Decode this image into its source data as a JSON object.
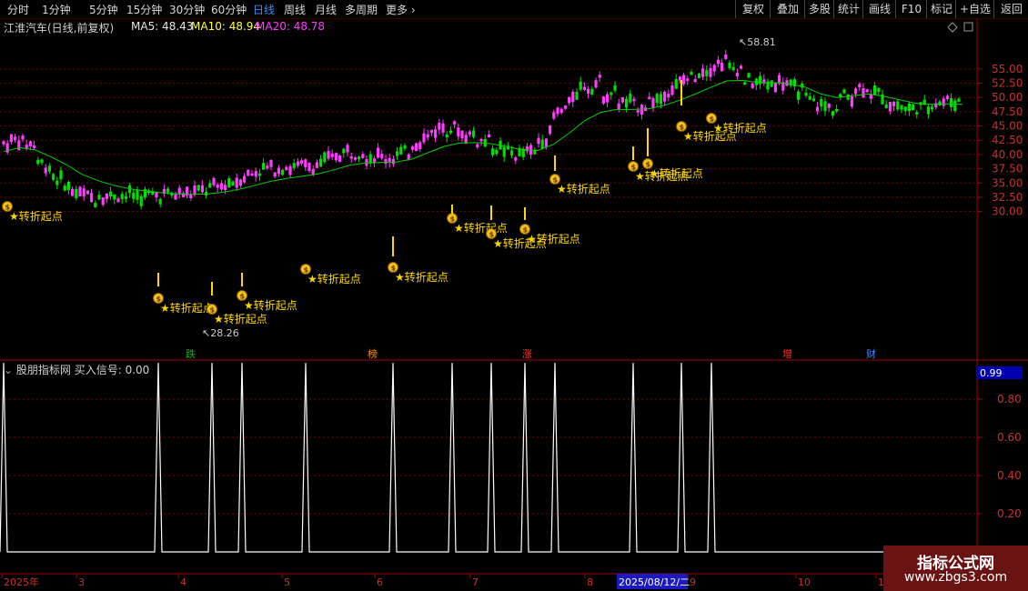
{
  "toolbar": {
    "periods": [
      "分时",
      "1分钟",
      "5分钟",
      "15分钟",
      "30分钟",
      "60分钟",
      "日线",
      "周线",
      "月线",
      "多周期",
      "更多"
    ],
    "active_period": "日线",
    "right_buttons": [
      "复权",
      "叠加",
      "多股",
      "统计",
      "画线",
      "F10",
      "标记",
      "+自选",
      "返回"
    ]
  },
  "stock": {
    "title": "江淮汽车(日线,前复权)",
    "ma5_label": "MA5: 48.43",
    "ma10_label": "MA10: 48.94",
    "ma20_label": "MA20: 48.78"
  },
  "colors": {
    "up_candle": "#ff3cff",
    "down_candle": "#00e000",
    "ma_line": "#00d000",
    "grid": "#7a0000",
    "axis_text": "#c83030",
    "signal_text": "#ffd700"
  },
  "main_panel": {
    "price_axis_labels": [
      "55.00",
      "52.50",
      "50.00",
      "47.50",
      "45.00",
      "42.50",
      "40.00",
      "37.50",
      "35.00",
      "32.50",
      "30.00"
    ],
    "high_marker": "58.81",
    "low_marker": "28.26",
    "signal_label": "转折起点",
    "event_tags": [
      "跌",
      "榜",
      "涨",
      "增",
      "财"
    ]
  },
  "sub_panel": {
    "title": "股朋指标网 买入信号: 0.00",
    "current_value_badge": "0.99",
    "axis_labels": [
      "0.80",
      "0.60",
      "0.40",
      "0.20"
    ]
  },
  "date_axis": {
    "labels": [
      "2025年",
      "3",
      "4",
      "5",
      "6",
      "7",
      "8",
      "9",
      "10",
      "1"
    ],
    "cursor_label": "2025/08/12/二"
  },
  "chart_data": {
    "type": "line",
    "series": [
      {
        "name": "MA20",
        "values": [
          40.5,
          41.2,
          40.8,
          39.6,
          38.2,
          36.5,
          35.4,
          34.6,
          34.0,
          33.6,
          33.3,
          33.1,
          33.0,
          33.1,
          33.4,
          33.9,
          34.6,
          35.3,
          35.8,
          36.2,
          36.6,
          37.3,
          38.1,
          38.5,
          38.6,
          38.7,
          39.2,
          40.3,
          41.4,
          42.0,
          42.1,
          41.9,
          41.4,
          40.8,
          40.7,
          41.8,
          43.8,
          46.0,
          47.4,
          47.9,
          47.9,
          48.0,
          48.6,
          49.5,
          50.6,
          51.8,
          52.9,
          53.0,
          52.6,
          52.6,
          52.4,
          51.8,
          50.6,
          50.0,
          50.3,
          50.6,
          50.2,
          49.6,
          49.0,
          48.8,
          48.9,
          48.8
        ]
      }
    ],
    "price_range": [
      27.5,
      60.0
    ],
    "signal_range": [
      0,
      1
    ],
    "buy_signal_count": 16,
    "signal_label": "转折起点"
  }
}
